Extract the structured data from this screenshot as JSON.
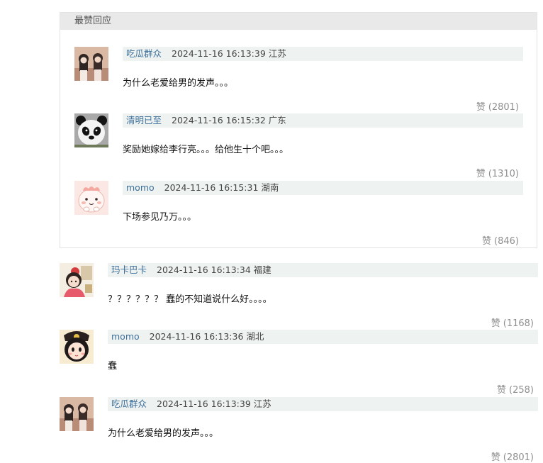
{
  "top_section": {
    "title": "最赞回应",
    "comments": [
      {
        "user": "吃瓜群众",
        "time": "2024-11-16 16:13:39",
        "location": "江苏",
        "text": "为什么老爱给男的发声。。。",
        "like_label": "赞",
        "likes": "(2801)"
      },
      {
        "user": "清明已至",
        "time": "2024-11-16 16:15:32",
        "location": "广东",
        "text": "奖励她嫁给李行亮。。。给他生十个吧。。。",
        "like_label": "赞",
        "likes": "(1310)"
      },
      {
        "user": "momo",
        "time": "2024-11-16 16:15:31",
        "location": "湖南",
        "text": "下场参见乃万。。。",
        "like_label": "赞",
        "likes": "(846)"
      }
    ]
  },
  "comments": [
    {
      "user": "玛卡巴卡",
      "time": "2024-11-16 16:13:34",
      "location": "福建",
      "text": "？？？？？？ 蠢的不知道说什么好。。。。",
      "like_label": "赞",
      "likes": "(1168)"
    },
    {
      "user": "momo",
      "time": "2024-11-16 16:13:36",
      "location": "湖北",
      "text": "蠢",
      "like_label": "赞",
      "likes": "(258)"
    },
    {
      "user": "吃瓜群众",
      "time": "2024-11-16 16:13:39",
      "location": "江苏",
      "text": "为什么老爱给男的发声。。。",
      "like_label": "赞",
      "likes": "(2801)"
    }
  ]
}
